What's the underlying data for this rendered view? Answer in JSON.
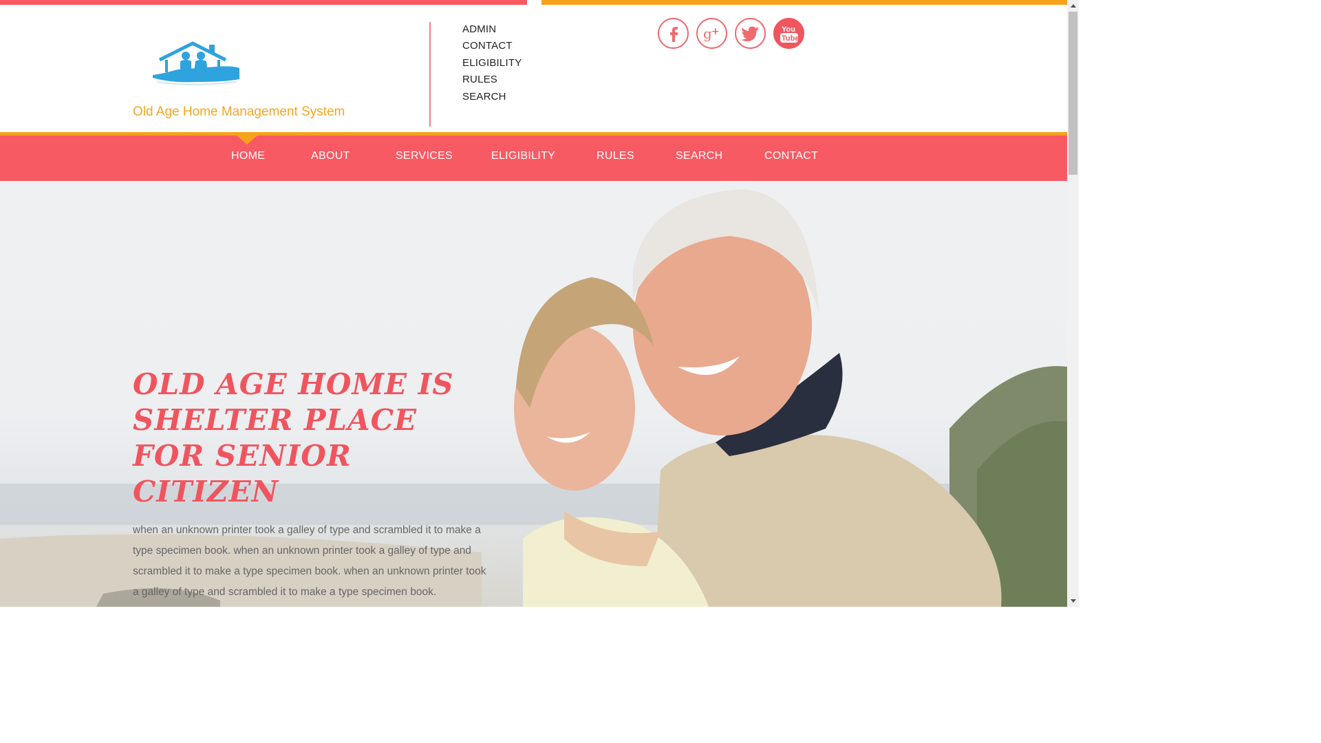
{
  "brand": {
    "title": "Old Age Home Management System",
    "logo": "house-with-elderly-couple-logo"
  },
  "top_links": [
    "ADMIN",
    "CONTACT",
    "ELIGIBILITY",
    "RULES",
    "SEARCH"
  ],
  "social": [
    {
      "name": "facebook-icon",
      "glyph": "f"
    },
    {
      "name": "google-plus-icon",
      "glyph": "g+"
    },
    {
      "name": "twitter-icon",
      "glyph": "bird"
    },
    {
      "name": "youtube-icon",
      "glyph": "You Tube"
    }
  ],
  "nav": {
    "items": [
      "HOME",
      "ABOUT",
      "SERVICES",
      "ELIGIBILITY",
      "RULES",
      "SEARCH",
      "CONTACT"
    ],
    "active": "HOME"
  },
  "hero": {
    "heading": "OLD AGE HOME IS SHELTER PLACE FOR SENIOR CITIZEN",
    "text": "when an unknown printer took a galley of type and scrambled it to make a type specimen book. when an unknown printer took a galley of type and scrambled it to make a type specimen book. when an unknown printer took a galley of type and scrambled it to make a type specimen book.",
    "image": "smiling-elderly-couple-on-beach"
  },
  "colors": {
    "coral": "#f85a63",
    "orange": "#f7a21b",
    "logo_blue": "#2ea3dd"
  }
}
